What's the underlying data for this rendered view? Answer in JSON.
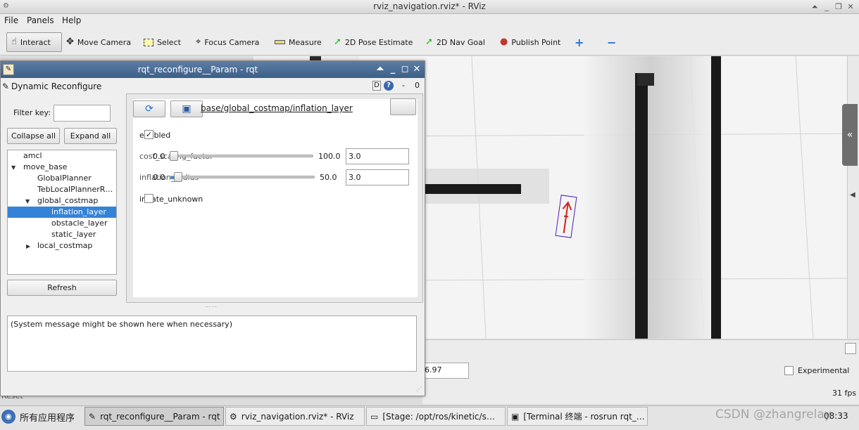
{
  "rviz": {
    "title": "rviz_navigation.rviz* - RViz",
    "menu": [
      "File",
      "Panels",
      "Help"
    ],
    "tools": [
      {
        "label": "Interact",
        "icon": "hand-pointer-icon"
      },
      {
        "label": "Move Camera",
        "icon": "move-arrows-icon"
      },
      {
        "label": "Select",
        "icon": "select-box-icon"
      },
      {
        "label": "Focus Camera",
        "icon": "crosshair-icon"
      },
      {
        "label": "Measure",
        "icon": "ruler-icon"
      },
      {
        "label": "2D Pose Estimate",
        "icon": "green-arrow-icon"
      },
      {
        "label": "2D Nav Goal",
        "icon": "green-arrow-icon"
      },
      {
        "label": "Publish Point",
        "icon": "map-pin-icon"
      }
    ],
    "add_tool": "+",
    "remove_tool": "−",
    "time_value": "6.97",
    "experimental_label": "Experimental",
    "fps": "31 fps",
    "reset_label": "Reset",
    "collapse_glyph": "«"
  },
  "rqt": {
    "title": "rqt_reconfigure__Param - rqt",
    "plugin_title": "Dynamic Reconfigure",
    "plugin_ctrl_d": "D",
    "plugin_ctrl_help": "?",
    "plugin_ctrl_minus": "-",
    "plugin_ctrl_zero": "0",
    "filter_label": "Filter key:",
    "filter_value": "",
    "collapse_all": "Collapse all",
    "expand_all": "Expand all",
    "tree": [
      {
        "label": "amcl",
        "level": 0,
        "expander": ""
      },
      {
        "label": "move_base",
        "level": 0,
        "expander": "down"
      },
      {
        "label": "GlobalPlanner",
        "level": 1,
        "expander": ""
      },
      {
        "label": "TebLocalPlannerR…",
        "level": 1,
        "expander": ""
      },
      {
        "label": "global_costmap",
        "level": 1,
        "expander": "down"
      },
      {
        "label": "inflation_layer",
        "level": 2,
        "expander": "",
        "selected": true
      },
      {
        "label": "obstacle_layer",
        "level": 2,
        "expander": ""
      },
      {
        "label": "static_layer",
        "level": 2,
        "expander": ""
      },
      {
        "label": "local_costmap",
        "level": 1,
        "expander": "right"
      }
    ],
    "refresh": "Refresh",
    "param_path": "base/global_costmap/inflation_layer",
    "params": {
      "enabled_label": "enabled",
      "enabled_checked": "✓",
      "cost_scaling_label": "cost_scaling_factor",
      "cost_scaling_min": "0.0",
      "cost_scaling_max": "100.0",
      "cost_scaling_value": "3.0",
      "cost_scaling_fraction": 0.03,
      "inflation_label": "inflation_radius",
      "inflation_min": "0.0",
      "inflation_max": "50.0",
      "inflation_value": "3.0",
      "inflation_fraction": 0.06,
      "inflate_unknown_label": "inflate_unknown"
    },
    "system_message": "(System message might be shown here when necessary)"
  },
  "taskbar": {
    "start_label": "所有应用程序",
    "tasks": [
      {
        "label": "rqt_reconfigure__Param - rqt",
        "active": true
      },
      {
        "label": "rviz_navigation.rviz* - RViz",
        "active": false
      },
      {
        "label": "[Stage: /opt/ros/kinetic/s…",
        "active": false
      },
      {
        "label": "[Terminal 终端 - rosrun rqt_…",
        "active": false
      }
    ],
    "clock": "08:33",
    "watermark": "CSDN @zhangrelay"
  },
  "colors": {
    "selection": "#3483d8",
    "rqt_titlebar": "#4a6d96",
    "obstacle": "#1a1a1a"
  }
}
